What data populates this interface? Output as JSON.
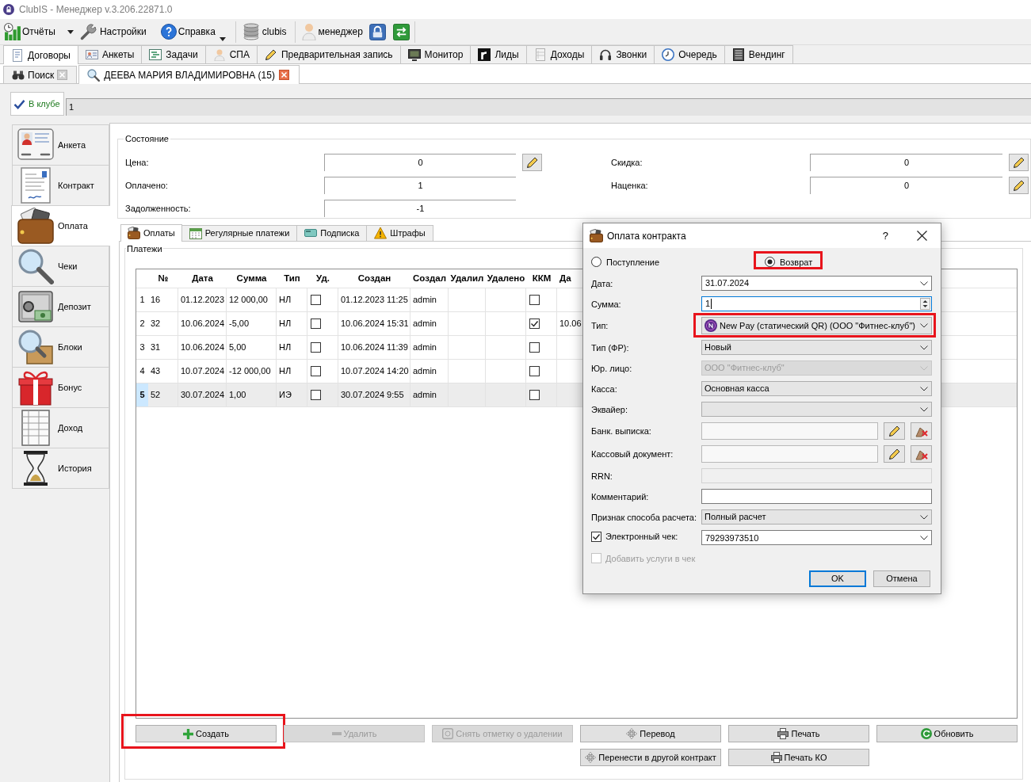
{
  "window": {
    "title": "ClubIS - Менеджер v.3.206.22871.0"
  },
  "toolbar": {
    "groups": [
      [
        {
          "label": "Отчёты",
          "kind": "split"
        },
        {
          "label": "Настройки",
          "kind": "button"
        },
        {
          "label": "Справка",
          "kind": "menu"
        }
      ],
      [
        {
          "label": "clubis",
          "kind": "button"
        }
      ],
      [
        {
          "label": "менеджер",
          "kind": "button"
        }
      ]
    ]
  },
  "tabs": [
    {
      "label": "Договоры",
      "selected": true
    },
    {
      "label": "Анкеты",
      "selected": false
    },
    {
      "label": "Задачи",
      "selected": false
    },
    {
      "label": "СПА",
      "selected": false
    },
    {
      "label": "Предварительная запись",
      "selected": false
    },
    {
      "label": "Монитор",
      "selected": false
    },
    {
      "label": "Лиды",
      "selected": false
    },
    {
      "label": "Доходы",
      "selected": false
    },
    {
      "label": "Звонки",
      "selected": false
    },
    {
      "label": "Очередь",
      "selected": false
    },
    {
      "label": "Вендинг",
      "selected": false
    }
  ],
  "documents": [
    {
      "label": "Поиск",
      "selected": false
    },
    {
      "label": "ДЕЕВА МАРИЯ ВЛАДИМИРОВНА (15)",
      "selected": true
    }
  ],
  "status": {
    "label": "В клубе",
    "value": "1"
  },
  "sidebar": {
    "items": [
      {
        "label": "Анкета",
        "selected": false
      },
      {
        "label": "Контракт",
        "selected": false
      },
      {
        "label": "Оплата",
        "selected": true
      },
      {
        "label": "Чеки",
        "selected": false
      },
      {
        "label": "Депозит",
        "selected": false
      },
      {
        "label": "Блоки",
        "selected": false
      },
      {
        "label": "Бонус",
        "selected": false
      },
      {
        "label": "Доход",
        "selected": false
      },
      {
        "label": "История",
        "selected": false
      }
    ]
  },
  "state": {
    "title": "Состояние",
    "left": [
      {
        "label": "Цена:",
        "value": "0",
        "editable": true
      },
      {
        "label": "Оплачено:",
        "value": "1",
        "editable": false
      },
      {
        "label": "Задолженность:",
        "value": "-1",
        "editable": false
      }
    ],
    "right": [
      {
        "label": "Скидка:",
        "value": "0",
        "editable": true
      },
      {
        "label": "Наценка:",
        "value": "0",
        "editable": true
      }
    ]
  },
  "payment_tabs": [
    {
      "label": "Оплаты",
      "selected": true
    },
    {
      "label": "Регулярные платежи",
      "selected": false
    },
    {
      "label": "Подписка",
      "selected": false
    },
    {
      "label": "Штрафы",
      "selected": false
    }
  ],
  "payments": {
    "title": "Платежи",
    "columns": [
      "№",
      "Дата",
      "Сумма",
      "Тип",
      "Уд.",
      "Создан",
      "Создал",
      "Удалил",
      "Удалено",
      "ККМ",
      "Да"
    ],
    "rows": [
      {
        "row": "1",
        "number": "16",
        "date": "01.12.2023",
        "sum": "12 000,00",
        "type": "НЛ",
        "deleted": false,
        "created": "01.12.2023 11:25",
        "author": "admin",
        "kkm": false,
        "selected": false
      },
      {
        "row": "2",
        "number": "32",
        "date": "10.06.2024",
        "sum": "-5,00",
        "type": "НЛ",
        "deleted": false,
        "created": "10.06.2024 15:31",
        "author": "admin",
        "kkm": true,
        "column_11": "10.06",
        "selected": false
      },
      {
        "row": "3",
        "number": "31",
        "date": "10.06.2024",
        "sum": "5,00",
        "type": "НЛ",
        "deleted": false,
        "created": "10.06.2024 11:39",
        "author": "admin",
        "kkm": false,
        "selected": false
      },
      {
        "row": "4",
        "number": "43",
        "date": "10.07.2024",
        "sum": "-12 000,00",
        "type": "НЛ",
        "deleted": false,
        "created": "10.07.2024 14:20",
        "author": "admin",
        "kkm": false,
        "selected": false
      },
      {
        "row": "5",
        "number": "52",
        "date": "30.07.2024",
        "sum": "1,00",
        "type": "ИЭ",
        "deleted": false,
        "created": "30.07.2024 9:55",
        "author": "admin",
        "kkm": false,
        "selected": true
      }
    ]
  },
  "buttons": [
    [
      {
        "label": "Создать",
        "disabled": false,
        "highlighted": true
      },
      {
        "label": "Удалить",
        "disabled": true,
        "highlighted": false
      },
      {
        "label": "Снять отметку о удалении",
        "disabled": true,
        "highlighted": false
      },
      {
        "label": "Перевод",
        "disabled": false,
        "highlighted": false
      },
      {
        "label": "Печать",
        "disabled": false,
        "highlighted": false
      },
      {
        "label": "Обновить",
        "disabled": false,
        "highlighted": false
      }
    ],
    [
      {
        "label": "Перенести в другой контракт",
        "disabled": false,
        "highlighted": false
      },
      {
        "label": "Печать КО",
        "disabled": false,
        "highlighted": false
      }
    ]
  ],
  "dialog": {
    "title": "Оплата контракта",
    "help": "?",
    "modes": [
      {
        "label": "Поступление",
        "selected": false,
        "highlighted": false
      },
      {
        "label": "Возврат",
        "selected": true,
        "highlighted": true
      }
    ],
    "fields": [
      {
        "label": "Дата:",
        "kind": "combo",
        "value": "31.07.2024",
        "disabled": false,
        "focused": false,
        "highlighted": false
      },
      {
        "label": "Сумма:",
        "kind": "spin",
        "value": "1",
        "disabled": false,
        "focused": true,
        "highlighted": false
      },
      {
        "label": "Тип:",
        "kind": "select_icon",
        "value": "New Pay (статический QR) (ООО \"Фитнес-клуб\")",
        "disabled": false,
        "focused": false,
        "highlighted": true
      },
      {
        "label": "Тип (ФР):",
        "kind": "select",
        "value": "Новый",
        "disabled": false,
        "focused": false,
        "highlighted": false
      },
      {
        "label": "Юр. лицо:",
        "kind": "select",
        "value": "ООО \"Фитнес-клуб\"",
        "disabled": true,
        "focused": false,
        "highlighted": false
      },
      {
        "label": "Касса:",
        "kind": "select",
        "value": "Основная касса",
        "disabled": false,
        "focused": false,
        "highlighted": false
      },
      {
        "label": "Эквайер:",
        "kind": "select",
        "disabled": false,
        "focused": false,
        "highlighted": false
      },
      {
        "label": "Банк. выписка:",
        "kind": "document",
        "disabled": false,
        "focused": false,
        "highlighted": false
      },
      {
        "label": "Кассовый документ:",
        "kind": "document",
        "disabled": false,
        "focused": false,
        "highlighted": false
      },
      {
        "label": "RRN:",
        "kind": "text",
        "disabled": true,
        "focused": false,
        "highlighted": false
      },
      {
        "label": "Комментарий:",
        "kind": "text",
        "disabled": false,
        "focused": false,
        "highlighted": false
      },
      {
        "label": "Признак способа расчета:",
        "kind": "select",
        "value": "Полный расчет",
        "disabled": false,
        "focused": false,
        "highlighted": false
      },
      {
        "label": "Электронный чек:",
        "kind": "check_combo",
        "checked": true,
        "value": "79293973510",
        "disabled": false,
        "focused": false,
        "highlighted": false
      }
    ],
    "options": [
      {
        "label": "Добавить услуги в чек",
        "checked": false,
        "disabled": true
      }
    ],
    "buttons": [
      {
        "label": "OK",
        "default": true
      },
      {
        "label": "Отмена",
        "default": false
      }
    ]
  }
}
